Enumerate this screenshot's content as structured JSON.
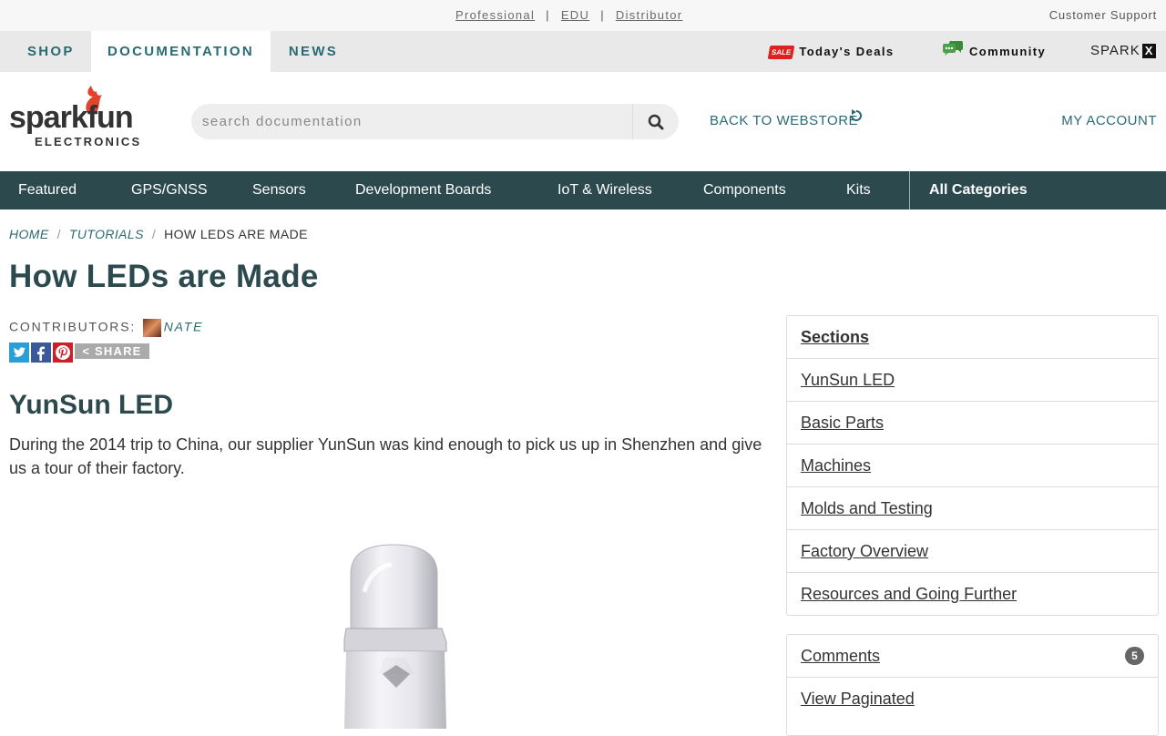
{
  "utility": {
    "links": [
      "Professional",
      "EDU",
      "Distributor"
    ],
    "customer_support": "Customer Support"
  },
  "nav": {
    "tabs": [
      "SHOP",
      "DOCUMENTATION",
      "NEWS"
    ],
    "deals_label": "Today's Deals",
    "deals_badge": "SALE",
    "community_label": "Community",
    "sparkx_text": "SPARK",
    "sparkx_x": "X"
  },
  "header": {
    "logo_text": "sparkfun",
    "logo_sub": "ELECTRONICS",
    "search_placeholder": "search documentation",
    "back_to_webstore": "BACK TO WEBSTORE",
    "my_account": "MY ACCOUNT"
  },
  "categories": [
    "Featured",
    "GPS/GNSS",
    "Sensors",
    "Development Boards",
    "IoT & Wireless",
    "Components",
    "Kits",
    "All Categories"
  ],
  "breadcrumb": {
    "home": "HOME",
    "tutorials": "TUTORIALS",
    "current": "HOW LEDS ARE MADE"
  },
  "article": {
    "title": "How LEDs are Made",
    "contributors_label": "CONTRIBUTORS:",
    "contributor_name": "NATE",
    "share_label": "SHARE",
    "section_heading": "YunSun LED",
    "body": "During the 2014 trip to China, our supplier YunSun was kind enough to pick us up in Shenzhen and give us a tour of their factory."
  },
  "sidebar": {
    "sections_heading": "Sections",
    "sections": [
      "YunSun LED",
      "Basic Parts",
      "Machines",
      "Molds and Testing",
      "Factory Overview",
      "Resources and Going Further"
    ],
    "comments_label": "Comments",
    "comments_count": "5",
    "view_paginated": "View Paginated"
  },
  "colors": {
    "teal": "#2a6a74",
    "dark_teal": "#2c4a4e",
    "sale_red": "#e02020",
    "community_green": "#3a8a3a"
  }
}
